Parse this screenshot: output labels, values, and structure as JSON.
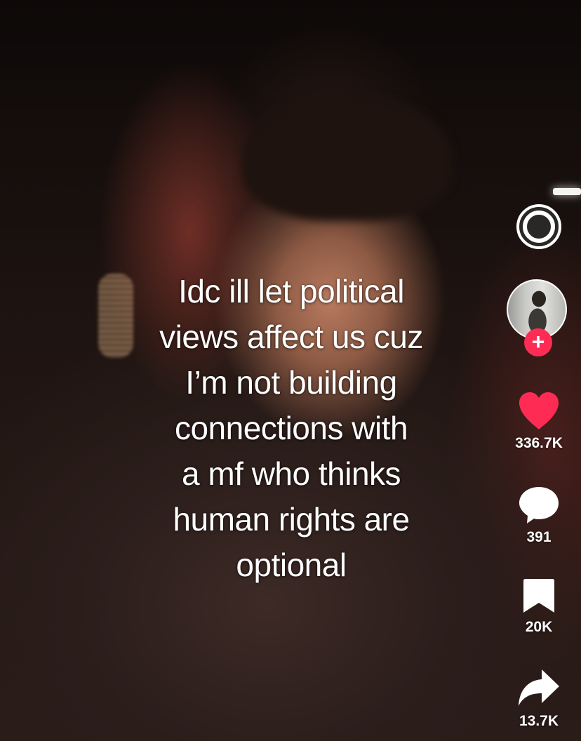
{
  "caption": {
    "lines": [
      "Idc ill let political",
      "views affect us cuz",
      "I’m not building",
      "connections with",
      "a mf who thinks",
      "human rights are",
      "optional"
    ]
  },
  "actions": {
    "like_count": "336.7K",
    "comment_count": "391",
    "save_count": "20K",
    "share_count": "13.7K"
  },
  "follow": {
    "symbol": "+"
  },
  "colors": {
    "like": "#fe2c55",
    "follow": "#fe2c55",
    "text": "#ffffff"
  },
  "icons": [
    "sound-disc-icon",
    "avatar",
    "plus-icon",
    "heart-icon",
    "comment-bubble-icon",
    "bookmark-icon",
    "share-arrow-icon"
  ]
}
